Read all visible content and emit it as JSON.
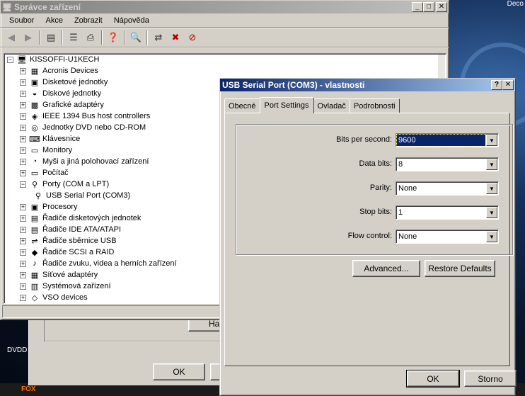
{
  "desktop": {
    "corner_label": "Deco",
    "dvd_label": "DVDD"
  },
  "device_manager": {
    "title": "Správce zařízení",
    "menu": [
      "Soubor",
      "Akce",
      "Zobrazit",
      "Nápověda"
    ],
    "tree": {
      "root": "KISSOFFI-U1KECH",
      "items": [
        {
          "label": "Acronis Devices",
          "icon": "chip-icon"
        },
        {
          "label": "Disketové jednotky",
          "icon": "floppy-icon"
        },
        {
          "label": "Diskové jednotky",
          "icon": "disk-icon"
        },
        {
          "label": "Grafické adaptéry",
          "icon": "display-adapter-icon"
        },
        {
          "label": "IEEE 1394 Bus host controllers",
          "icon": "firewire-icon"
        },
        {
          "label": "Jednotky DVD nebo CD-ROM",
          "icon": "cdrom-icon"
        },
        {
          "label": "Klávesnice",
          "icon": "keyboard-icon"
        },
        {
          "label": "Monitory",
          "icon": "monitor-icon"
        },
        {
          "label": "Myši a jiná polohovací zařízení",
          "icon": "mouse-icon"
        },
        {
          "label": "Počítač",
          "icon": "computer-icon"
        },
        {
          "label": "Porty (COM a LPT)",
          "icon": "port-icon",
          "expanded": true
        },
        {
          "label": "USB Serial Port (COM3)",
          "icon": "serial-port-icon",
          "child": true
        },
        {
          "label": "Procesory",
          "icon": "cpu-icon"
        },
        {
          "label": "Řadiče disketových jednotek",
          "icon": "floppy-controller-icon"
        },
        {
          "label": "Řadiče IDE ATA/ATAPI",
          "icon": "ide-controller-icon"
        },
        {
          "label": "Řadiče sběrnice USB",
          "icon": "usb-icon"
        },
        {
          "label": "Řadiče SCSI a RAID",
          "icon": "scsi-icon"
        },
        {
          "label": "Řadiče zvuku, videa a herních zařízení",
          "icon": "sound-icon"
        },
        {
          "label": "Síťové adaptéry",
          "icon": "network-icon"
        },
        {
          "label": "Systémová zařízení",
          "icon": "system-icon"
        },
        {
          "label": "VSO devices",
          "icon": "vso-icon"
        }
      ]
    }
  },
  "background_window": {
    "ok_label": "OK",
    "partial_button": "Ha"
  },
  "dialog": {
    "title": "USB Serial Port (COM3)  - vlastnosti",
    "tabs": [
      "Obecné",
      "Port Settings",
      "Ovladač",
      "Podrobnosti"
    ],
    "active_tab": "Port Settings",
    "fields": {
      "bits_per_second": {
        "label": "Bits per second:",
        "value": "9600"
      },
      "data_bits": {
        "label": "Data bits:",
        "value": "8"
      },
      "parity": {
        "label": "Parity:",
        "value": "None"
      },
      "stop_bits": {
        "label": "Stop bits:",
        "value": "1"
      },
      "flow_control": {
        "label": "Flow control:",
        "value": "None"
      }
    },
    "advanced_label": "Advanced...",
    "restore_label": "Restore Defaults",
    "ok_label": "OK",
    "cancel_label": "Storno"
  },
  "title_buttons": {
    "minimize": "_",
    "maximize": "□",
    "close": "✕",
    "help": "?"
  },
  "taskbar": {
    "firefox_label": "FOX"
  }
}
